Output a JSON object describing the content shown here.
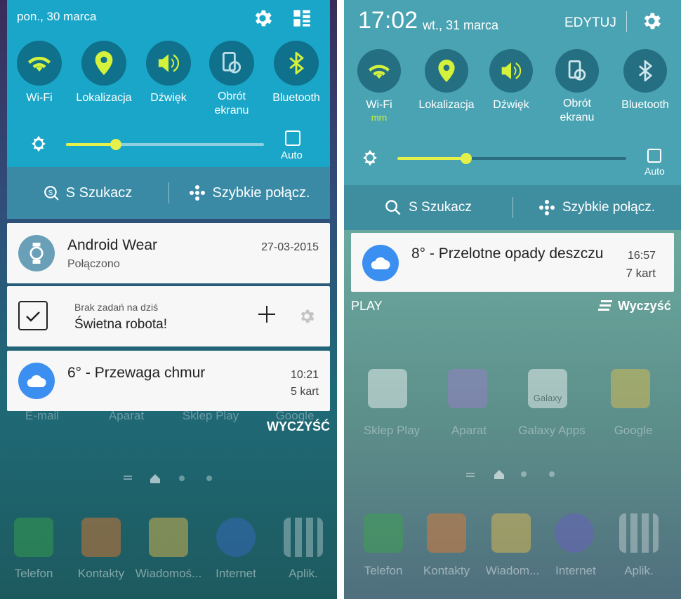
{
  "left": {
    "date": "pon., 30 marca",
    "toggles": [
      {
        "label": "Wi-Fi",
        "icon": "wifi-icon"
      },
      {
        "label": "Lokalizacja",
        "icon": "location-icon"
      },
      {
        "label": "Dźwięk",
        "icon": "sound-icon"
      },
      {
        "label": "Obrót ekranu",
        "icon": "rotate-icon"
      },
      {
        "label": "Bluetooth",
        "icon": "bluetooth-icon"
      }
    ],
    "brightness": 0.25,
    "auto_label": "Auto",
    "search_label": "S Szukacz",
    "quick_connect_label": "Szybkie połącz.",
    "notifications": {
      "wear": {
        "title": "Android Wear",
        "sub": "Połączono",
        "date": "27-03-2015"
      },
      "tasks": {
        "sub": "Brak zadań na dziś",
        "title": "Świetna robota!"
      },
      "weather": {
        "title": "6° - Przewaga chmur",
        "time": "10:21",
        "count": "5 kart"
      }
    },
    "clear_label": "WYCZYŚĆ",
    "home_labels": [
      "E-mail",
      "Aparat",
      "Sklep Play",
      "Google"
    ],
    "dock": [
      "Telefon",
      "Kontakty",
      "Wiadomoś...",
      "Internet",
      "Aplik."
    ]
  },
  "right": {
    "time": "17:02",
    "date": "wt., 31 marca",
    "edit_label": "EDYTUJ",
    "toggles": [
      {
        "label": "Wi-Fi",
        "sub": "mrn",
        "icon": "wifi-icon"
      },
      {
        "label": "Lokalizacja",
        "icon": "location-icon"
      },
      {
        "label": "Dźwięk",
        "icon": "sound-icon"
      },
      {
        "label": "Obrót ekranu",
        "icon": "rotate-icon"
      },
      {
        "label": "Bluetooth",
        "icon": "bluetooth-icon"
      }
    ],
    "brightness": 0.3,
    "auto_label": "Auto",
    "search_label": "S Szukacz",
    "quick_connect_label": "Szybkie połącz.",
    "notifications": {
      "weather": {
        "title": "8° - Przelotne opady deszczu",
        "time": "16:57",
        "count": "7 kart"
      }
    },
    "play_label": "PLAY",
    "clear_label": "Wyczyść",
    "home_labels": [
      "Sklep Play",
      "Aparat",
      "Galaxy Apps",
      "Google"
    ],
    "galaxy_text": "Galaxy",
    "dock": [
      "Telefon",
      "Kontakty",
      "Wiadom...",
      "Internet",
      "Aplik."
    ]
  },
  "colors": {
    "accent": "#d4f23c",
    "weather_icon": "#3b8ff0"
  }
}
